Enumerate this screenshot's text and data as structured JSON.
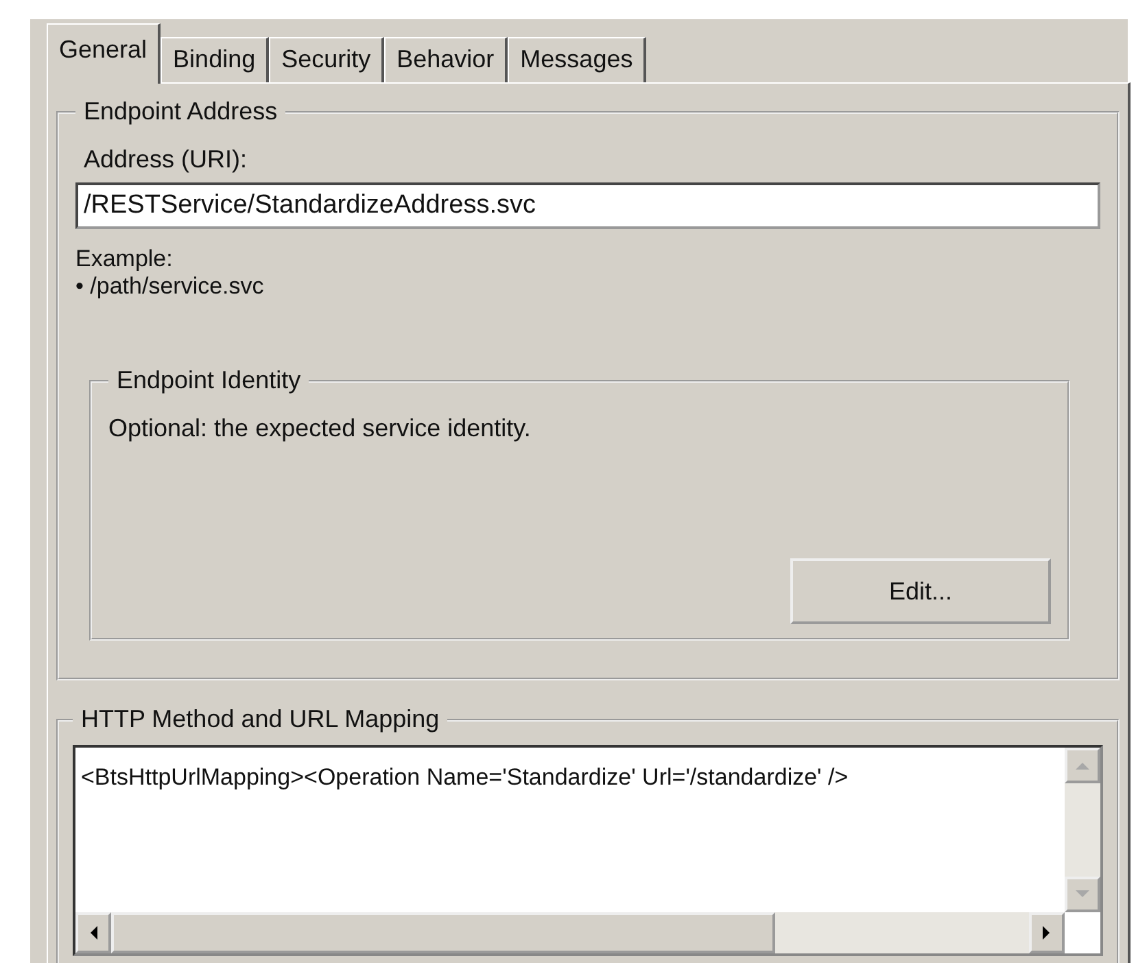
{
  "tabs": [
    {
      "label": "General",
      "selected": true
    },
    {
      "label": "Binding",
      "selected": false
    },
    {
      "label": "Security",
      "selected": false
    },
    {
      "label": "Behavior",
      "selected": false
    },
    {
      "label": "Messages",
      "selected": false
    }
  ],
  "endpoint_address": {
    "legend": "Endpoint Address",
    "address_label": "Address (URI):",
    "address_value": "/RESTService/StandardizeAddress.svc",
    "example_label": "Example:",
    "example_item": "• /path/service.svc"
  },
  "endpoint_identity": {
    "legend": "Endpoint Identity",
    "description": "Optional: the expected service identity.",
    "edit_button": "Edit..."
  },
  "http_mapping": {
    "legend": "HTTP Method and URL Mapping",
    "value": "<BtsHttpUrlMapping><Operation Name='Standardize' Url='/standardize' />"
  }
}
